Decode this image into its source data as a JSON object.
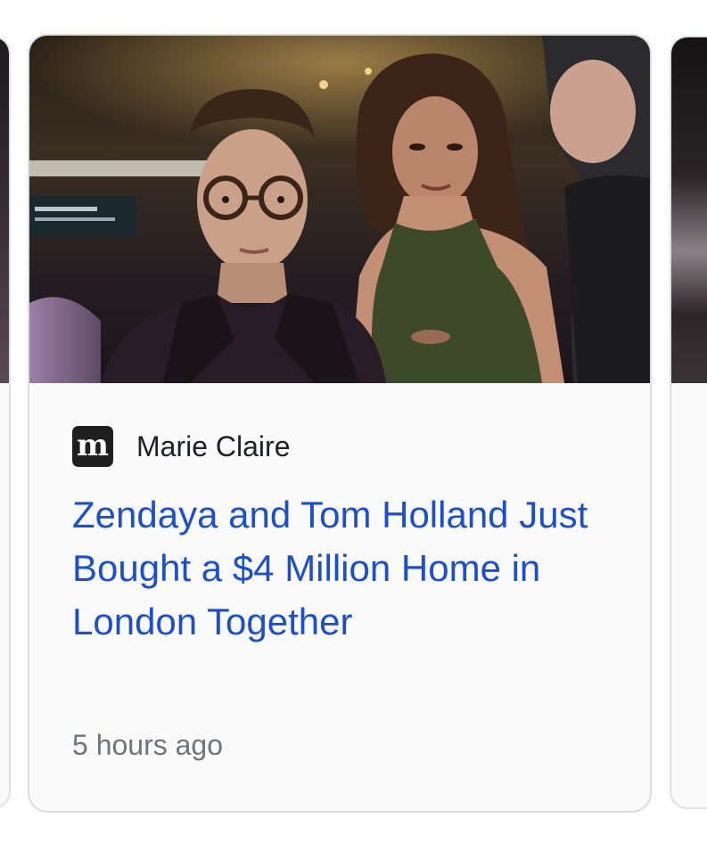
{
  "result": {
    "image_alt": "Tom Holland and Zendaya",
    "source": {
      "logo_letter": "m",
      "name": "Marie Claire"
    },
    "headline": "Zendaya and Tom Holland Just Bought a $4 Million Home in London Together",
    "timestamp": "5 hours ago"
  },
  "colors": {
    "headline": "#1a4fd0",
    "source_text": "#202124",
    "timestamp": "#70757a",
    "card_border": "#dadce0",
    "card_background": "#fafafa",
    "logo_background": "#1f1f1f"
  },
  "icons": {
    "source_logo": "marie-claire-logo-icon"
  }
}
